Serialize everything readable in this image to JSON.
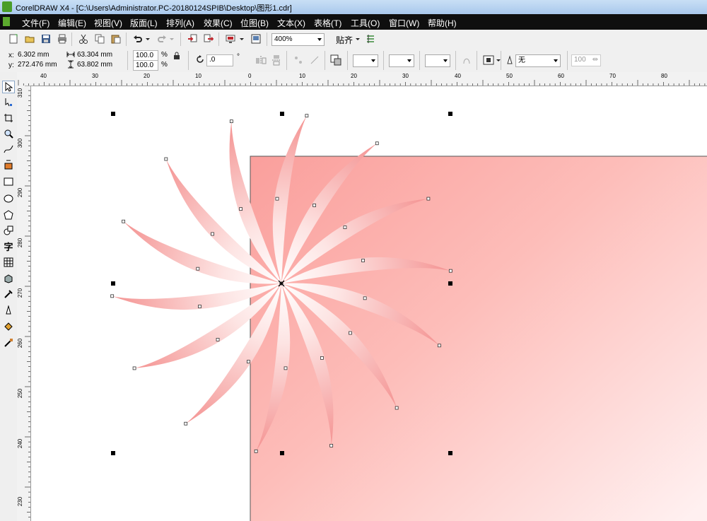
{
  "window": {
    "title": "CorelDRAW X4 - [C:\\Users\\Administrator.PC-20180124SPIB\\Desktop\\图形1.cdr]"
  },
  "menu": [
    "文件(F)",
    "编辑(E)",
    "视图(V)",
    "版面(L)",
    "排列(A)",
    "效果(C)",
    "位图(B)",
    "文本(X)",
    "表格(T)",
    "工具(O)",
    "窗口(W)",
    "帮助(H)"
  ],
  "toolbar": {
    "zoom": "400%",
    "snap_label": "贴齐"
  },
  "property_bar": {
    "x_label": "x:",
    "x_value": "6.302 mm",
    "y_label": "y:",
    "y_value": "272.476 mm",
    "width_value": "63.304 mm",
    "height_value": "63.802 mm",
    "scale_x": "100.0",
    "scale_y": "100.0",
    "percent": "%",
    "rotation": ".0",
    "degree": "°",
    "outline": "无",
    "opacity": "100"
  },
  "ruler": {
    "top_labels": [
      "40",
      "30",
      "20",
      "10",
      "0",
      "10",
      "20",
      "30",
      "40",
      "50",
      "60",
      "70",
      "80"
    ],
    "left_labels": [
      "310",
      "300",
      "290",
      "280",
      "270",
      "260",
      "250",
      "240",
      "230"
    ]
  },
  "colors": {
    "menubar_bg": "#0f0f0f",
    "rect_gradient_start": "#fa9f9c",
    "rect_gradient_end": "#fff0f0",
    "petal_inner": "#ffffff",
    "petal_outer": "#f49392",
    "selection_handle": "#000000"
  },
  "icons": [
    "new-icon",
    "open-icon",
    "save-icon",
    "print-icon",
    "cut-icon",
    "copy-icon",
    "paste-icon",
    "undo-icon",
    "redo-icon",
    "import-icon",
    "export-icon",
    "application-launcher-icon",
    "welcome-icon",
    "snap-options-icon",
    "lock-ratio-icon",
    "rotate-icon",
    "mirror-horizontal-icon",
    "mirror-vertical-icon",
    "pick-tool-icon",
    "shape-tool-icon",
    "crop-tool-icon",
    "zoom-tool-icon",
    "freehand-tool-icon",
    "smart-fill-icon",
    "rectangle-tool-icon",
    "ellipse-tool-icon",
    "polygon-tool-icon",
    "basic-shapes-icon",
    "text-tool-icon",
    "table-tool-icon",
    "interactive-tool-icon",
    "eyedropper-tool-icon",
    "outline-tool-icon",
    "fill-tool-icon",
    "interactive-fill-icon"
  ]
}
